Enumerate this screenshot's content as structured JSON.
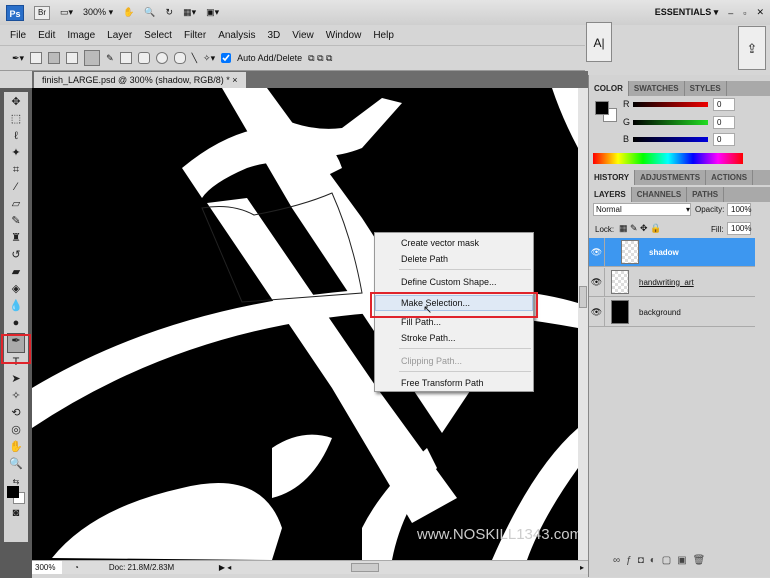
{
  "appbar": {
    "ps": "Ps",
    "br": "Br",
    "zoom": "300%",
    "workspace": "ESSENTIALS"
  },
  "menu": [
    "File",
    "Edit",
    "Image",
    "Layer",
    "Select",
    "Filter",
    "Analysis",
    "3D",
    "View",
    "Window",
    "Help"
  ],
  "options": {
    "auto_add_delete": "Auto Add/Delete",
    "checked": true
  },
  "document": {
    "tab": "finish_LARGE.psd @ 300% (shadow, RGB/8) *",
    "close": "×",
    "watermark": "www.NOSKILL1343.com"
  },
  "context_menu": {
    "items": [
      {
        "label": "Create vector mask",
        "enabled": true
      },
      {
        "label": "Delete Path",
        "enabled": true
      },
      {
        "label": "Define Custom Shape...",
        "enabled": true
      },
      {
        "label": "Make Selection...",
        "enabled": true,
        "highlighted": true
      },
      {
        "label": "Fill Path...",
        "enabled": true
      },
      {
        "label": "Stroke Path...",
        "enabled": true
      },
      {
        "label": "Clipping Path...",
        "enabled": false
      },
      {
        "label": "Free Transform Path",
        "enabled": true
      }
    ]
  },
  "status": {
    "zoom": "300%",
    "doc": "Doc: 21.8M/2.83M"
  },
  "color_panel": {
    "tabs": [
      "COLOR",
      "SWATCHES",
      "STYLES"
    ],
    "r": "0",
    "g": "0",
    "b": "0",
    "labels": [
      "R",
      "G",
      "B"
    ]
  },
  "history_tabs": [
    "HISTORY",
    "ADJUSTMENTS",
    "ACTIONS"
  ],
  "layers_panel": {
    "tabs": [
      "LAYERS",
      "CHANNELS",
      "PATHS"
    ],
    "blend": "Normal",
    "opacity_label": "Opacity:",
    "opacity": "100%",
    "lock_label": "Lock:",
    "fill_label": "Fill:",
    "fill": "100%",
    "layers": [
      {
        "name": "shadow",
        "selected": true
      },
      {
        "name": "handwriting_art",
        "selected": false
      },
      {
        "name": "background",
        "selected": false
      }
    ]
  },
  "colors": {
    "highlight": "#3d97f0",
    "annotation": "#e0242b"
  }
}
